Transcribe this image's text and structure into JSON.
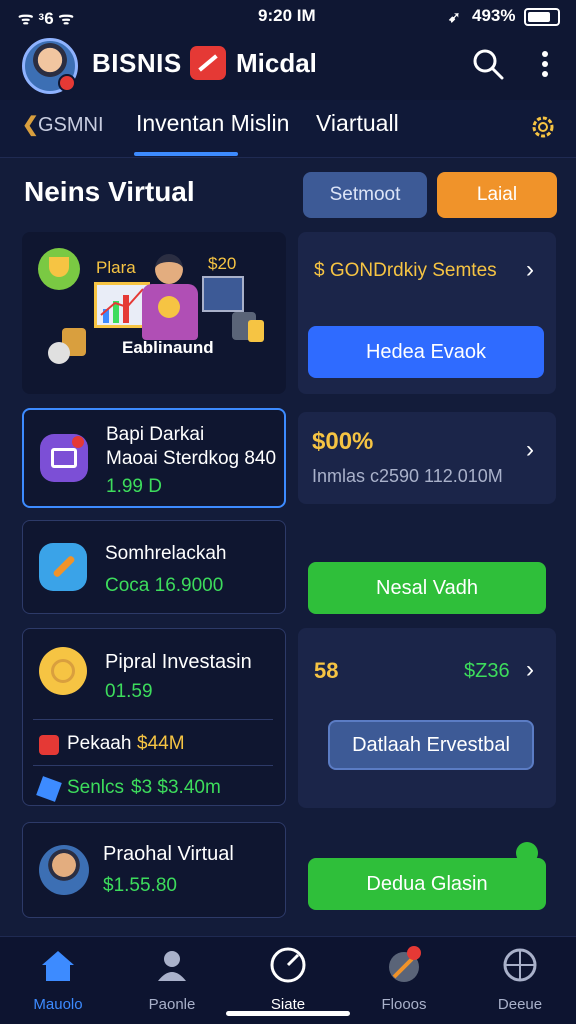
{
  "status_bar": {
    "left": "ᯤ ᵌ6 ᯤ",
    "time": "9:20 IM",
    "battery": "493%"
  },
  "header": {
    "title": "BISNIS",
    "subtitle": "Micdal"
  },
  "tabs": {
    "back_label": "GSMNI",
    "items": [
      "Inventan Mislin",
      "Viartuall"
    ]
  },
  "section": {
    "title": "Neins Virtual",
    "setting_label": "Setmoot",
    "lainnya_label": "Laial"
  },
  "promo": {
    "label_left": "Plara",
    "label_right": "$20",
    "caption": "Eablinaund",
    "series": "$ GONDrdkiy Semtes",
    "cta": "Hedea Evaok"
  },
  "item1": {
    "title": "Bapi Darkai",
    "subtitle": "Maoai Sterdkog 840",
    "value": "1.99 D"
  },
  "stat1": {
    "percent": "$00%",
    "label": "Inmlas",
    "value": "c2590 112.010M"
  },
  "item2": {
    "title": "Somhrelackah",
    "value": "Coca 16.9000"
  },
  "btn_green1": "Nesal Vadh",
  "item3": {
    "title": "Pipral Investasin",
    "value": "01.59",
    "sub1_label": "Pekaah",
    "sub1_value": "$44M",
    "sub2_label": "Senlcs",
    "sub2_value": "$3 $3.40m"
  },
  "stat2": {
    "left": "58",
    "right": "$Z36"
  },
  "btn_blue2": "Datlaah Ervestbal",
  "item4": {
    "title": "Praohal Virtual",
    "value": "$1.55.80"
  },
  "btn_green2": "Dedua Glasin",
  "nav": [
    "Mauolo",
    "Paonle",
    "Siate",
    "Flooos",
    "Deeue"
  ],
  "colors": {
    "bg": "#131c3a",
    "accent_blue": "#3d8bff",
    "accent_green": "#3ddc5c",
    "accent_orange": "#f0932a",
    "gold": "#f6c443"
  }
}
